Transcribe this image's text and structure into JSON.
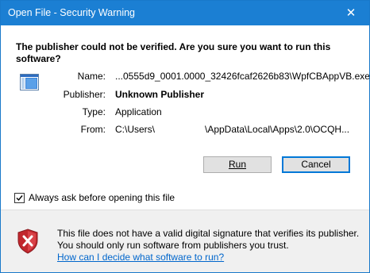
{
  "window": {
    "title": "Open File - Security Warning",
    "close_glyph": "✕"
  },
  "question": "The publisher could not be verified.  Are you sure you want to run this software?",
  "details": {
    "name_label": "Name:",
    "name_value": "...0555d9_0001.0000_32426fcaf2626b83\\WpfCBAppVB.exe",
    "publisher_label": "Publisher:",
    "publisher_value": "Unknown Publisher",
    "type_label": "Type:",
    "type_value": "Application",
    "from_label": "From:",
    "from_value_part1": "C:\\Users\\",
    "from_value_part2": "\\AppData\\Local\\Apps\\2.0\\OCQH..."
  },
  "buttons": {
    "run_label": "Run",
    "cancel_label": "Cancel"
  },
  "checkbox": {
    "label": "Always ask before opening this file",
    "checked": true
  },
  "warning": {
    "text": "This file does not have a valid digital signature that verifies its publisher.  You should only run software from publishers you trust.",
    "link": "How can I decide what software to run?"
  },
  "icons": {
    "app": "application-window-icon",
    "shield": "security-shield-x-icon",
    "close": "close-icon",
    "check": "checkmark-icon"
  },
  "colors": {
    "titlebar": "#1b7fd3",
    "default_button_border": "#0078d7",
    "link": "#0066cc",
    "shield_red": "#c1272d"
  }
}
